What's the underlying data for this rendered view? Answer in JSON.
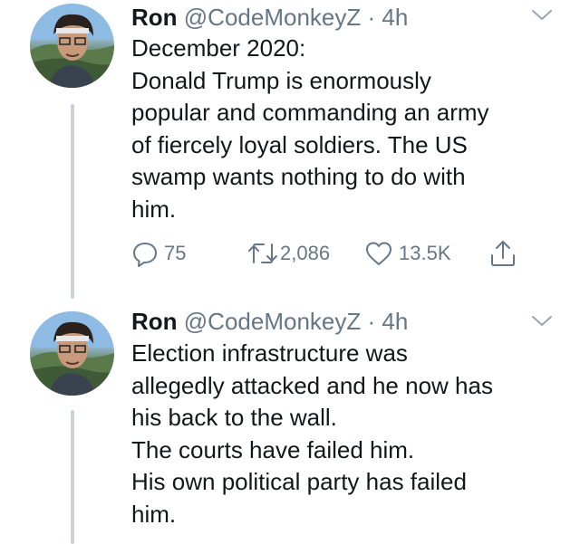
{
  "tweets": [
    {
      "author_name": "Ron",
      "handle": "@CodeMonkeyZ",
      "separator": "·",
      "time": "4h",
      "lines": [
        "December 2020:",
        "Donald Trump is enormously",
        "popular and commanding an army",
        "of fiercely loyal soldiers. The US",
        "swamp wants nothing to do with",
        "him."
      ],
      "replies": "75",
      "retweets": "2,086",
      "likes": "13.5K"
    },
    {
      "author_name": "Ron",
      "handle": "@CodeMonkeyZ",
      "separator": "·",
      "time": "4h",
      "lines": [
        "Election infrastructure was",
        "allegedly attacked and he now has",
        "his back to the wall.",
        "The courts have failed him.",
        "His own political party has failed",
        "him."
      ]
    }
  ],
  "colors": {
    "text": "#14171a",
    "muted": "#657786",
    "thread_line": "#c9d1d9",
    "background": "#ffffff"
  }
}
